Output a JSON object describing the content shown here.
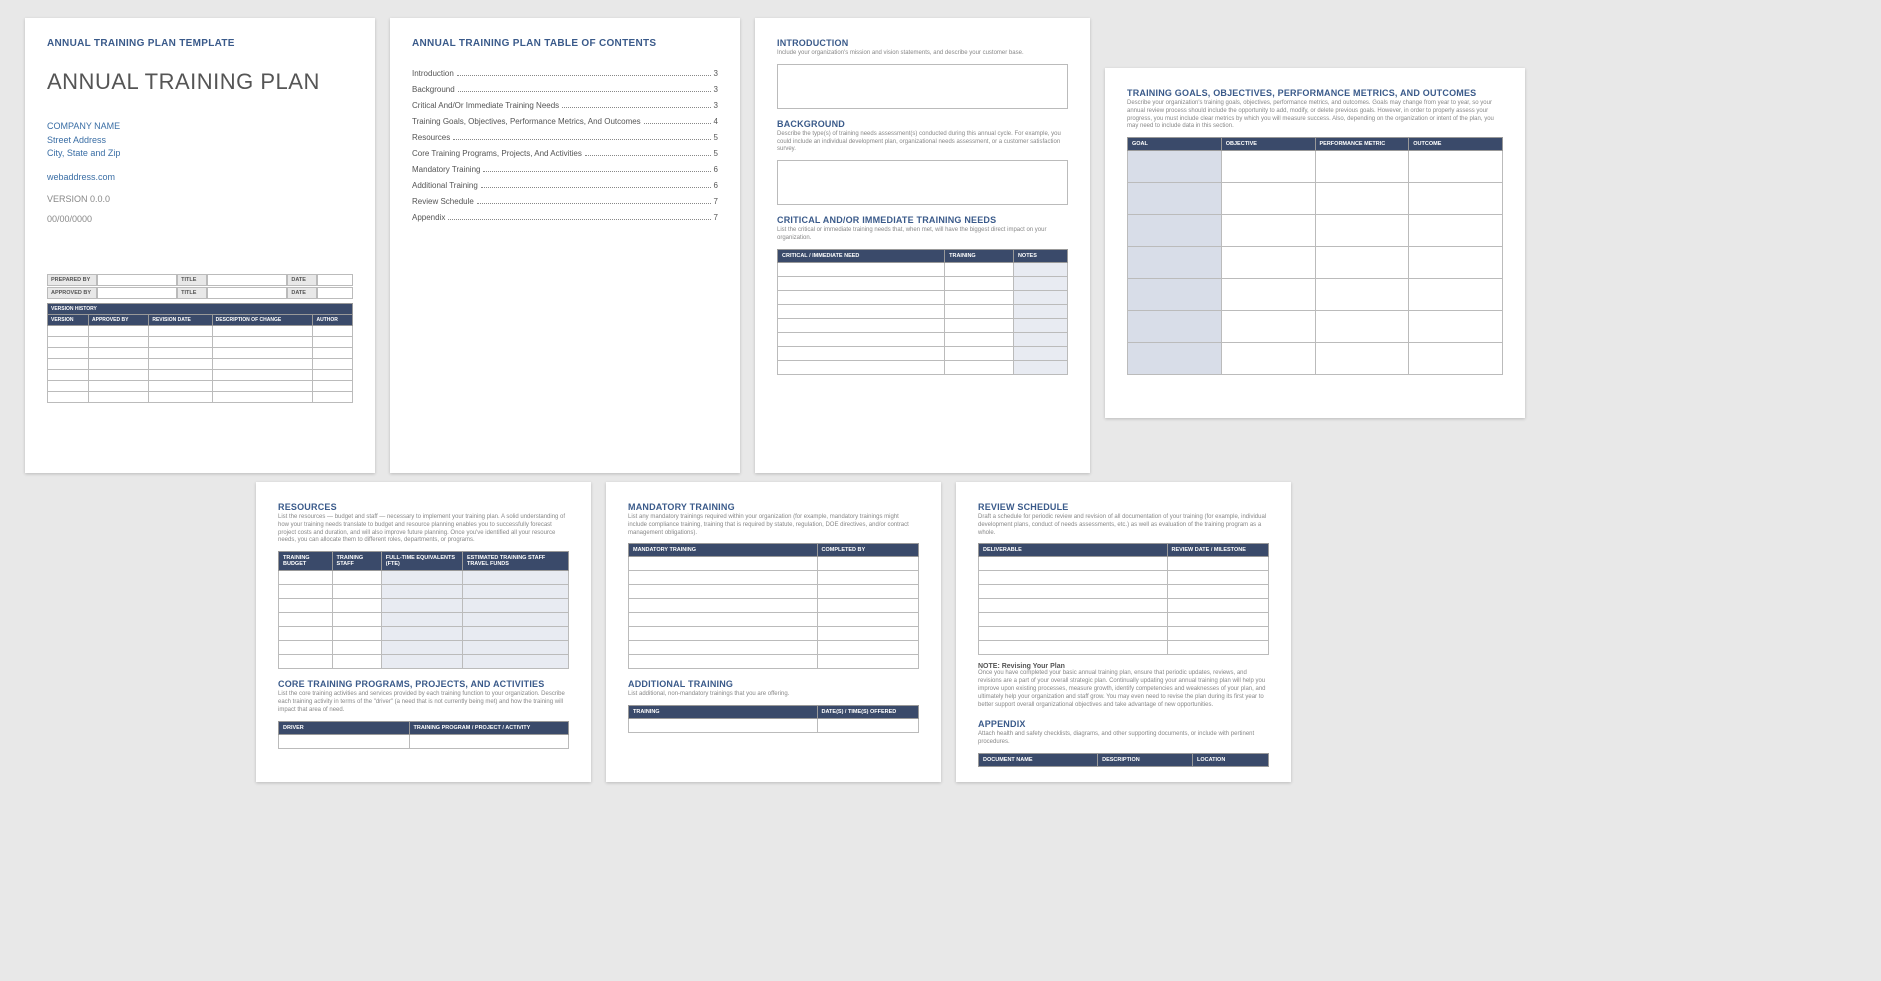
{
  "p1": {
    "header": "ANNUAL TRAINING PLAN TEMPLATE",
    "title": "ANNUAL TRAINING PLAN",
    "company": "COMPANY NAME",
    "addr1": "Street Address",
    "addr2": "City, State and Zip",
    "web": "webaddress.com",
    "version": "VERSION 0.0.0",
    "date": "00/00/0000",
    "meta": {
      "prep": "PREPARED BY",
      "appr": "APPROVED BY",
      "titl": "TITLE",
      "dat": "DATE"
    },
    "vh": {
      "title": "VERSION HISTORY",
      "cols": [
        "VERSION",
        "APPROVED BY",
        "REVISION DATE",
        "DESCRIPTION OF CHANGE",
        "AUTHOR"
      ]
    }
  },
  "p2": {
    "header": "ANNUAL TRAINING PLAN TABLE OF CONTENTS",
    "toc": [
      {
        "label": "Introduction",
        "pg": "3"
      },
      {
        "label": "Background",
        "pg": "3"
      },
      {
        "label": "Critical And/Or Immediate Training Needs",
        "pg": "3"
      },
      {
        "label": "Training Goals, Objectives, Performance Metrics, And Outcomes",
        "pg": "4"
      },
      {
        "label": "Resources",
        "pg": "5"
      },
      {
        "label": "Core Training Programs, Projects, And Activities",
        "pg": "5"
      },
      {
        "label": "Mandatory Training",
        "pg": "6"
      },
      {
        "label": "Additional Training",
        "pg": "6"
      },
      {
        "label": "Review Schedule",
        "pg": "7"
      },
      {
        "label": "Appendix",
        "pg": "7"
      }
    ]
  },
  "p3": {
    "s1": {
      "h": "INTRODUCTION",
      "d": "Include your organization's mission and vision statements, and describe your customer base."
    },
    "s2": {
      "h": "BACKGROUND",
      "d": "Describe the type(s) of training needs assessment(s) conducted during this annual cycle. For example, you could include an individual development plan, organizational needs assessment, or a customer satisfaction survey."
    },
    "s3": {
      "h": "CRITICAL AND/OR IMMEDIATE TRAINING NEEDS",
      "d": "List the critical or immediate training needs that, when met, will have the biggest direct impact on your organization.",
      "cols": [
        "CRITICAL / IMMEDIATE NEED",
        "TRAINING",
        "NOTES"
      ]
    }
  },
  "p4": {
    "h": "TRAINING GOALS, OBJECTIVES, PERFORMANCE METRICS, AND OUTCOMES",
    "d": "Describe your organization's training goals, objectives, performance metrics, and outcomes. Goals may change from year to year, so your annual review process should include the opportunity to add, modify, or delete previous goals. However, in order to properly assess your progress, you must include clear metrics by which you will measure success. Also, depending on the organization or intent of the plan, you may need to include data in this section.",
    "cols": [
      "GOAL",
      "OBJECTIVE",
      "PERFORMANCE METRIC",
      "OUTCOME"
    ]
  },
  "p5": {
    "s1": {
      "h": "RESOURCES",
      "d": "List the resources — budget and staff — necessary to implement your training plan. A solid understanding of how your training needs translate to budget and resource planning enables you to successfully forecast project costs and duration, and will also improve future planning. Once you've identified all your resource needs, you can allocate them to different roles, departments, or programs.",
      "cols": [
        "TRAINING BUDGET",
        "TRAINING STAFF",
        "FULL-TIME EQUIVALENTS (FTE)",
        "ESTIMATED TRAINING STAFF TRAVEL FUNDS"
      ]
    },
    "s2": {
      "h": "CORE TRAINING PROGRAMS, PROJECTS, AND ACTIVITIES",
      "d": "List the core training activities and services provided by each training function to your organization. Describe each training activity in terms of the \"driver\" (a need that is not currently being met) and how the training will impact that area of need.",
      "cols": [
        "DRIVER",
        "TRAINING PROGRAM / PROJECT / ACTIVITY"
      ]
    }
  },
  "p6": {
    "s1": {
      "h": "MANDATORY TRAINING",
      "d": "List any mandatory trainings required within your organization (for example, mandatory trainings might include compliance training, training that is required by statute, regulation, DOE directives, and/or contract management obligations).",
      "cols": [
        "MANDATORY TRAINING",
        "COMPLETED BY"
      ]
    },
    "s2": {
      "h": "ADDITIONAL TRAINING",
      "d": "List additional, non-mandatory trainings that you are offering.",
      "cols": [
        "TRAINING",
        "DATE(S) / TIME(S) OFFERED"
      ]
    }
  },
  "p7": {
    "s1": {
      "h": "REVIEW SCHEDULE",
      "d": "Draft a schedule for periodic review and revision of all documentation of your training (for example, individual development plans, conduct of needs assessments, etc.) as well as evaluation of the training program as a whole.",
      "cols": [
        "DELIVERABLE",
        "REVIEW DATE / MILESTONE"
      ]
    },
    "note": {
      "h": "NOTE: Revising Your Plan",
      "d": "Once you have completed your basic annual training plan, ensure that periodic updates, reviews, and revisions are a part of your overall strategic plan. Continually updating your annual training plan will help you improve upon existing processes, measure growth, identify competencies and weaknesses of your plan, and ultimately help your organization and staff grow. You may even need to revise the plan during its first year to better support overall organizational objectives and take advantage of new opportunities."
    },
    "s2": {
      "h": "APPENDIX",
      "d": "Attach health and safety checklists, diagrams, and other supporting documents, or include with pertinent procedures.",
      "cols": [
        "DOCUMENT NAME",
        "DESCRIPTION",
        "LOCATION"
      ]
    }
  }
}
